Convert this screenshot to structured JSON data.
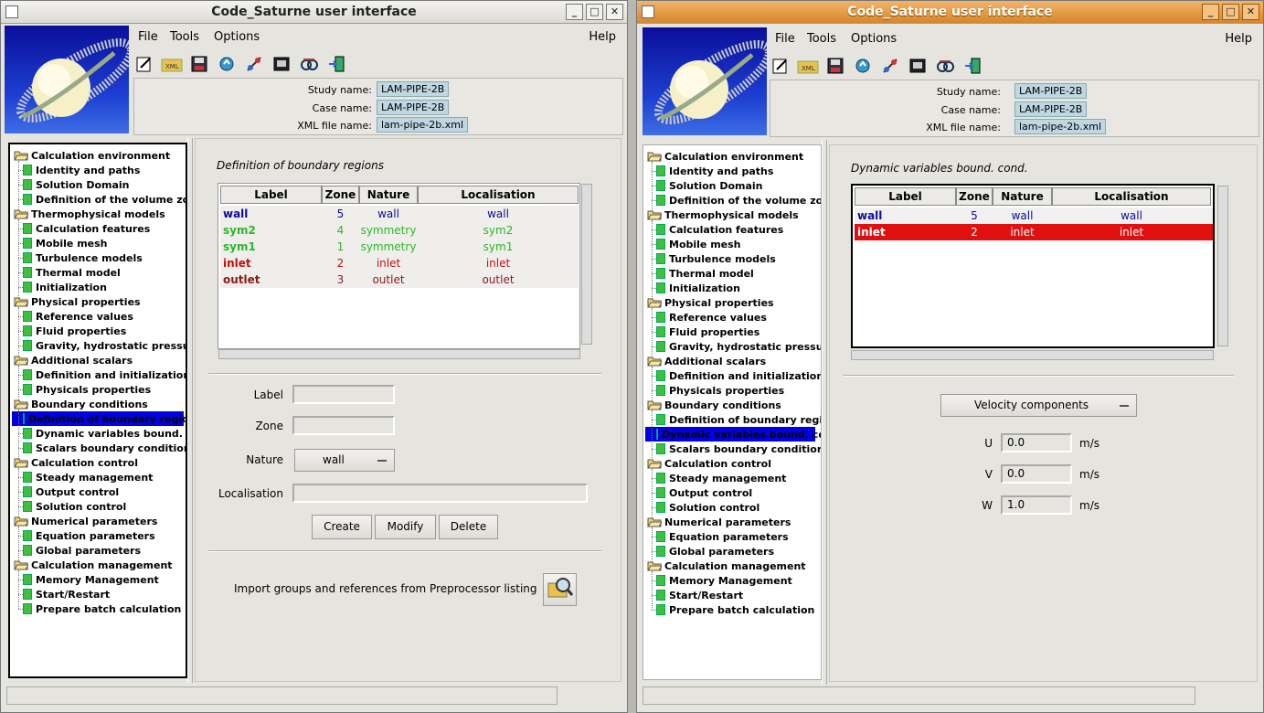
{
  "app_title": "Code_Saturne user interface",
  "window_buttons": {
    "minimize": "_",
    "maximize": "□",
    "close": "✕"
  },
  "menu": {
    "file": "File",
    "tools": "Tools",
    "options": "Options",
    "help": "Help"
  },
  "toolbar_icons": [
    "new-file-icon",
    "open-xml-icon",
    "save-icon",
    "refresh-icon",
    "satellite-icon",
    "preprocessor-icon",
    "identity-icon",
    "exit-icon"
  ],
  "study_info": {
    "study_label": "Study name:",
    "study_value": "LAM-PIPE-2B",
    "case_label": "Case name:",
    "case_value": "LAM-PIPE-2B",
    "xml_label": "XML file name:",
    "xml_value": "lam-pipe-2b.xml"
  },
  "tree": [
    {
      "label": "Calculation environment",
      "type": "folder"
    },
    {
      "label": "Identity and paths",
      "type": "leaf"
    },
    {
      "label": "Solution Domain",
      "type": "leaf"
    },
    {
      "label": "Definition of the volume zones",
      "type": "leaf"
    },
    {
      "label": "Thermophysical models",
      "type": "folder"
    },
    {
      "label": "Calculation features",
      "type": "leaf"
    },
    {
      "label": "Mobile mesh",
      "type": "leaf"
    },
    {
      "label": "Turbulence models",
      "type": "leaf"
    },
    {
      "label": "Thermal model",
      "type": "leaf"
    },
    {
      "label": "Initialization",
      "type": "leaf"
    },
    {
      "label": "Physical properties",
      "type": "folder"
    },
    {
      "label": "Reference values",
      "type": "leaf"
    },
    {
      "label": "Fluid properties",
      "type": "leaf"
    },
    {
      "label": "Gravity, hydrostatic pressure",
      "type": "leaf"
    },
    {
      "label": "Additional scalars",
      "type": "folder"
    },
    {
      "label": "Definition and initialization",
      "type": "leaf"
    },
    {
      "label": "Physicals properties",
      "type": "leaf"
    },
    {
      "label": "Boundary conditions",
      "type": "folder"
    },
    {
      "label": "Definition of boundary regions",
      "type": "leaf"
    },
    {
      "label": "Dynamic variables bound. cond.",
      "type": "leaf"
    },
    {
      "label": "Scalars boundary conditions",
      "type": "leaf"
    },
    {
      "label": "Calculation control",
      "type": "folder"
    },
    {
      "label": "Steady management",
      "type": "leaf"
    },
    {
      "label": "Output control",
      "type": "leaf"
    },
    {
      "label": "Solution control",
      "type": "leaf"
    },
    {
      "label": "Numerical parameters",
      "type": "folder"
    },
    {
      "label": "Equation parameters",
      "type": "leaf"
    },
    {
      "label": "Global parameters",
      "type": "leaf"
    },
    {
      "label": "Calculation management",
      "type": "folder"
    },
    {
      "label": "Memory Management",
      "type": "leaf"
    },
    {
      "label": "Start/Restart",
      "type": "leaf"
    },
    {
      "label": "Prepare batch calculation",
      "type": "leaf"
    }
  ],
  "left_panel": {
    "title": "Definition of boundary regions",
    "columns": [
      "Label",
      "Zone",
      "Nature",
      "Localisation"
    ],
    "rows": [
      {
        "label": "wall",
        "zone": "5",
        "nature": "wall",
        "localisation": "wall",
        "color": "#0b0b9a"
      },
      {
        "label": "sym2",
        "zone": "4",
        "nature": "symmetry",
        "localisation": "sym2",
        "color": "#2bb82b"
      },
      {
        "label": "sym1",
        "zone": "1",
        "nature": "symmetry",
        "localisation": "sym1",
        "color": "#2bb82b"
      },
      {
        "label": "inlet",
        "zone": "2",
        "nature": "inlet",
        "localisation": "inlet",
        "color": "#c01010"
      },
      {
        "label": "outlet",
        "zone": "3",
        "nature": "outlet",
        "localisation": "outlet",
        "color": "#8b1a1a"
      }
    ],
    "form": {
      "label_lbl": "Label",
      "label_value": "",
      "zone_lbl": "Zone",
      "zone_value": "",
      "nature_lbl": "Nature",
      "nature_value": "wall",
      "localisation_lbl": "Localisation",
      "localisation_value": ""
    },
    "buttons": {
      "create": "Create",
      "modify": "Modify",
      "delete": "Delete"
    },
    "import_text": "Import groups and references from Preprocessor listing"
  },
  "right_panel": {
    "title": "Dynamic variables bound. cond.",
    "columns": [
      "Label",
      "Zone",
      "Nature",
      "Localisation"
    ],
    "rows": [
      {
        "label": "wall",
        "zone": "5",
        "nature": "wall",
        "localisation": "wall",
        "selected": false
      },
      {
        "label": "inlet",
        "zone": "2",
        "nature": "inlet",
        "localisation": "inlet",
        "selected": true
      }
    ],
    "velocity_combo": "Velocity components",
    "fields": [
      {
        "name": "U",
        "value": "0.0",
        "unit": "m/s"
      },
      {
        "name": "V",
        "value": "0.0",
        "unit": "m/s"
      },
      {
        "name": "W",
        "value": "1.0",
        "unit": "m/s"
      }
    ]
  },
  "colors": {
    "selection_blue": "#0000e0",
    "selected_row": "#e01010",
    "field_bg": "#bfd7e3"
  }
}
